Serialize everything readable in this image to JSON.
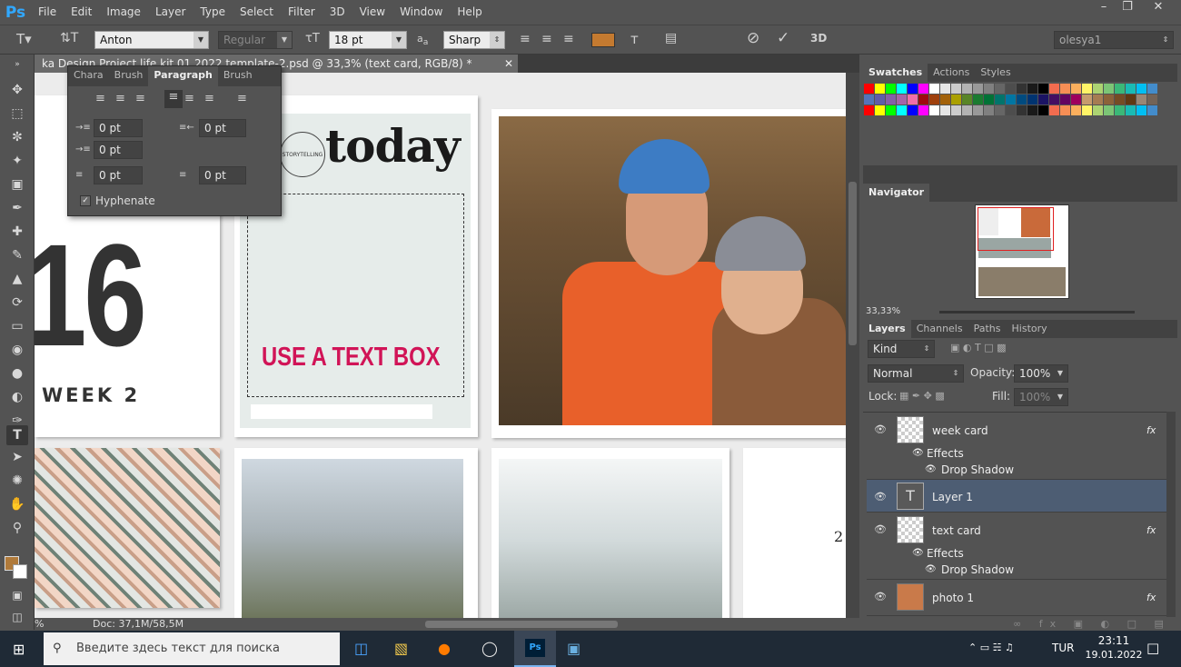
{
  "menu": [
    "File",
    "Edit",
    "Image",
    "Layer",
    "Type",
    "Select",
    "Filter",
    "3D",
    "View",
    "Window",
    "Help"
  ],
  "app_logo": "Ps",
  "options": {
    "font_family": "Anton",
    "font_style": "Regular",
    "font_size": "18 pt",
    "antialias": "Sharp",
    "text_color": "#c47a30",
    "workspace": "olesya1"
  },
  "document_tab": "ka Design Project life kit 01 2022 template-2.psd @ 33,3% (text card, RGB/8) *",
  "paragraph_panel": {
    "tabs": [
      "Chara",
      "Brush",
      "Paragraph",
      "Brush"
    ],
    "indent_left": "0 pt",
    "indent_right": "0 pt",
    "indent_first": "0 pt",
    "space_before": "0 pt",
    "space_after": "0 pt",
    "hyphenate_label": "Hyphenate"
  },
  "canvas": {
    "date_big": "16",
    "week_label": "WEEK 2",
    "today_text": "today",
    "stamp_text": "STORYTELLING",
    "textbox_text": "USE A TEXT BOX",
    "side_digit": "2"
  },
  "status": {
    "zoom": "%",
    "doc": "Doc: 37,1M/58,5M"
  },
  "swatches": {
    "tabs": [
      "Swatches",
      "Actions",
      "Styles"
    ]
  },
  "navigator": {
    "title": "Navigator",
    "zoom": "33,33%"
  },
  "layers_panel": {
    "tabs": [
      "Layers",
      "Channels",
      "Paths",
      "History"
    ],
    "kind": "Kind",
    "blend_mode": "Normal",
    "opacity_label": "Opacity:",
    "opacity": "100%",
    "lock_label": "Lock:",
    "fill_label": "Fill:",
    "fill": "100%",
    "layers": [
      {
        "name": "week card",
        "fx": "fx",
        "effects": "Effects",
        "effect": "Drop Shadow"
      },
      {
        "name": "Layer 1"
      },
      {
        "name": "text card",
        "fx": "fx",
        "effects": "Effects",
        "effect": "Drop Shadow"
      },
      {
        "name": "photo 1",
        "fx": "fx"
      }
    ]
  },
  "taskbar": {
    "search_placeholder": "Введите здесь текст для поиска",
    "lang": "TUR",
    "time": "23:11",
    "date": "19.01.2022"
  }
}
